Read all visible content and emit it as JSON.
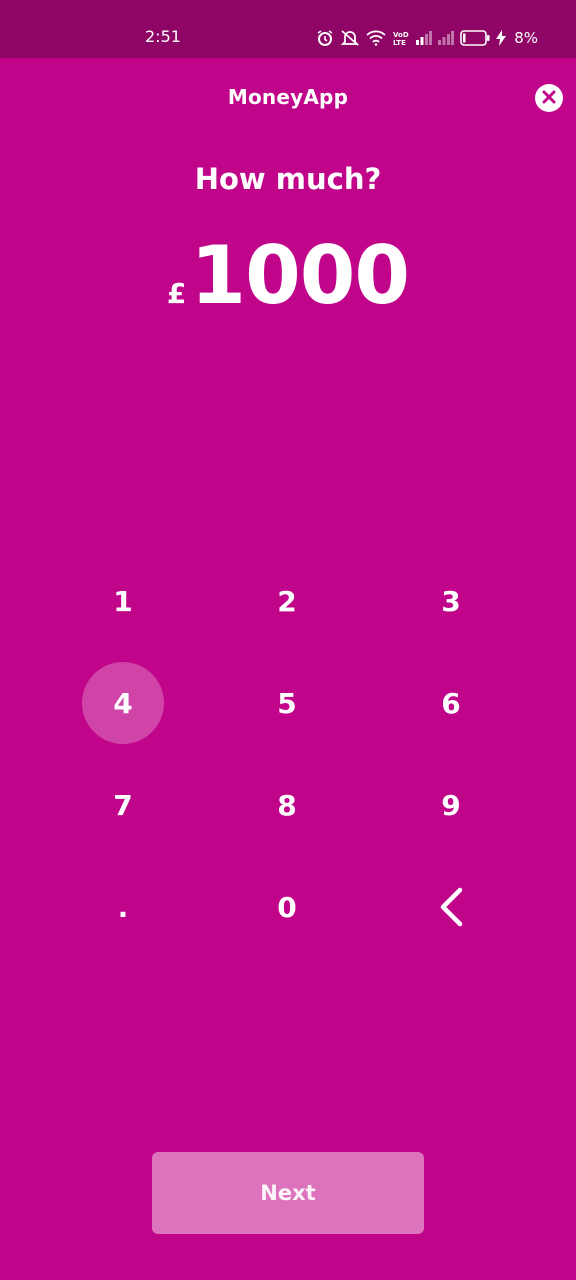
{
  "status_bar": {
    "time": "2:51",
    "battery_percent": "8%",
    "icons": [
      "alarm-icon",
      "mute-icon",
      "wifi-icon",
      "volte-icon",
      "signal-icon",
      "signal-icon",
      "battery-icon",
      "charging-icon"
    ]
  },
  "header": {
    "title": "MoneyApp",
    "close_icon": "close-icon"
  },
  "prompt": {
    "question": "How much?"
  },
  "amount": {
    "currency": "£",
    "value": "1000"
  },
  "keypad": {
    "keys": [
      "1",
      "2",
      "3",
      "4",
      "5",
      "6",
      "7",
      "8",
      "9",
      ".",
      "0"
    ],
    "backspace_icon": "chevron-left-icon",
    "pressed_key": "4"
  },
  "footer": {
    "next_label": "Next"
  },
  "colors": {
    "background": "#C0058A",
    "status_bar": "#8E0565",
    "next_button": "#DD72BD"
  }
}
